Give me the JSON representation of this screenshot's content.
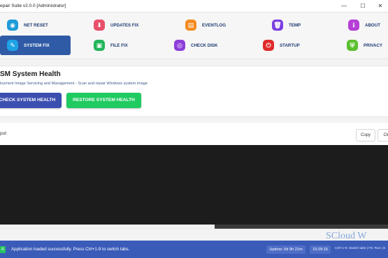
{
  "window": {
    "title": "epair Suite v2.0.0 [Administrator]"
  },
  "nav": [
    {
      "label": "NET RESET",
      "icon": "globe-icon",
      "color": "#1e9bd7",
      "glyph": "◉"
    },
    {
      "label": "UPDATES FIX",
      "icon": "download-icon",
      "color": "#e9506a",
      "glyph": "⬇"
    },
    {
      "label": "EVENTLOG",
      "icon": "document-icon",
      "color": "#f58b1f",
      "glyph": "▤"
    },
    {
      "label": "TEMP",
      "icon": "trash-icon",
      "color": "#7a3fe0",
      "glyph": "🗑"
    },
    {
      "label": "ABOUT",
      "icon": "info-icon",
      "color": "#b53fd6",
      "glyph": "ℹ"
    },
    {
      "label": "SYSTEM FIX",
      "icon": "wrench-icon",
      "color": "#1ea3e6",
      "glyph": "✎",
      "active": true
    },
    {
      "label": "FILE FIX",
      "icon": "file-icon",
      "color": "#21b55a",
      "glyph": "▣"
    },
    {
      "label": "CHECK DISK",
      "icon": "disk-icon",
      "color": "#8d3ed8",
      "glyph": "◎"
    },
    {
      "label": "STARTUP",
      "icon": "power-icon",
      "color": "#e02b2b",
      "glyph": "⏻"
    },
    {
      "label": "PRIVACY",
      "icon": "shield-icon",
      "color": "#5bbf2e",
      "glyph": "⛨"
    }
  ],
  "panel": {
    "title": "SM System Health",
    "subtitle": "loyment Image Servicing and Management - Scan and repair Windows system image",
    "check_button": "CHECK SYSTEM HEALTH",
    "restore_button": "RESTORE SYSTEM HEALTH"
  },
  "output": {
    "label": "put",
    "copy_button": "Copy",
    "clear_button": "Cle"
  },
  "status": {
    "badge": "A",
    "message": "Application loaded successfully. Press Ctrl+1-9 to switch tabs.",
    "uptime": "Uptime: 0d 9h 21m",
    "clock": "15:29:15",
    "hint": "Ctrl+1-9: Switch tabs | F5: Run | E"
  },
  "watermark": "SCloud W",
  "colors": {
    "accent": "#2f5aa6",
    "status_bar": "#3a5bb8",
    "restore": "#1fca60",
    "check": "#3b4fb0"
  }
}
